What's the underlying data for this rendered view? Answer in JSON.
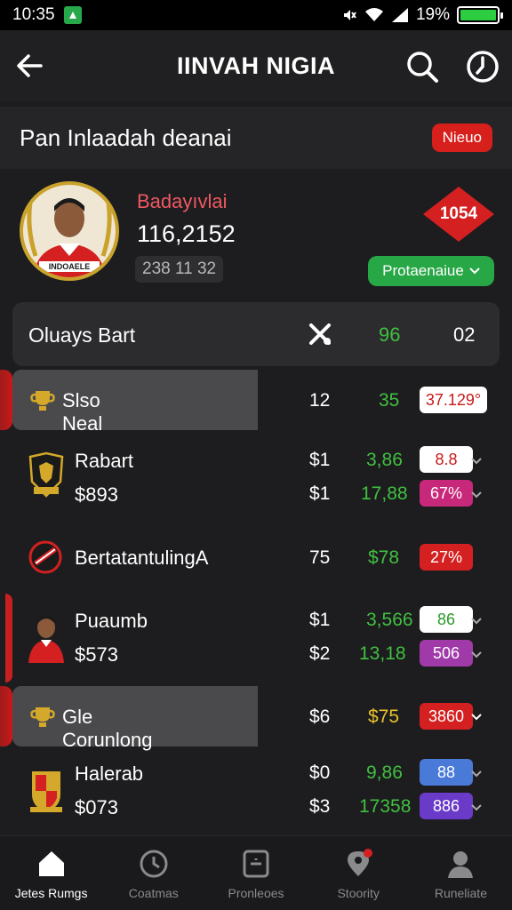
{
  "status_bar": {
    "time": "10:35",
    "battery": "19%"
  },
  "app_bar": {
    "title": "IINVAH NIGIA"
  },
  "section": {
    "title": "Pan Inlaadah deanai",
    "badge": "Nieuo"
  },
  "profile": {
    "name": "Badayıvlai",
    "score": "116,2152",
    "sub": "238 11 32",
    "jersey_text": "INDOAELE",
    "rank": "1054",
    "performance_label": "Protaenaiue"
  },
  "table": {
    "header": {
      "label": "Oluays Bart",
      "col2": "96",
      "col3": "02"
    },
    "rows": [
      {
        "label": "Slso Neal",
        "a": "12",
        "b": "35",
        "c": "37.129°"
      },
      {
        "label": "Rabart",
        "a": "$1",
        "b": "3,86",
        "c": "8.8",
        "label2": "$893",
        "a2": "$1",
        "b2": "17,88",
        "c2": "67%"
      },
      {
        "label": "BertatantulingA",
        "a": "75",
        "b": "$78",
        "c": "27%"
      },
      {
        "label": "Puaumb",
        "a": "$1",
        "b": "3,566",
        "c": "86",
        "label2": "$573",
        "a2": "$2",
        "b2": "13,18",
        "c2": "506"
      },
      {
        "label": "Gle Corunlong",
        "a": "$6",
        "b": "$75",
        "c": "3860"
      },
      {
        "label": "Halerab",
        "a": "$0",
        "b": "9,86",
        "c": "88",
        "label2": "$073",
        "a2": "$3",
        "b2": "17358",
        "c2": "886"
      }
    ]
  },
  "nav": [
    {
      "label": "Jetes Rumgs"
    },
    {
      "label": "Coatmas"
    },
    {
      "label": "Pronleoes"
    },
    {
      "label": "Stoority"
    },
    {
      "label": "Runeliate"
    }
  ],
  "colors": {
    "accent_red": "#d7201c",
    "accent_green": "#27a745",
    "background": "#1d1d1f"
  }
}
